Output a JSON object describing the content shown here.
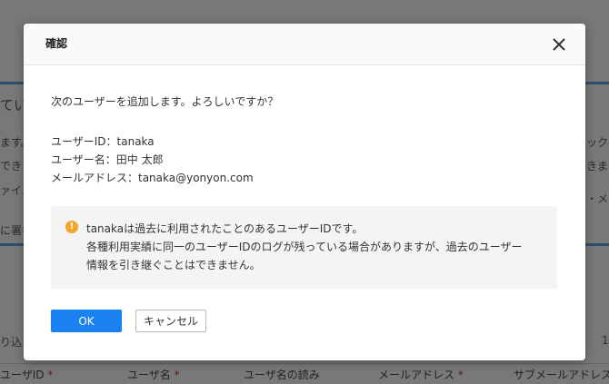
{
  "background": {
    "fragments": [
      "ていま",
      "ます。",
      "できま",
      "ァイル",
      "に署名",
      "ックス",
      "きます",
      "・メ",
      "り込",
      "1"
    ],
    "table_headers": [
      {
        "label": "ユーザID",
        "required": "*"
      },
      {
        "label": "ユーザ名",
        "required": "*"
      },
      {
        "label": "ユーザ名の読み",
        "required": ""
      },
      {
        "label": "メールアドレス",
        "required": "*"
      },
      {
        "label": "サブメールアドレス",
        "required": ""
      }
    ]
  },
  "dialog": {
    "title": "確認",
    "message": "次のユーザーを追加します。よろしいですか？",
    "user_id_line": "ユーザーID：tanaka",
    "user_name_line": "ユーザー名：田中 太郎",
    "email_line": "メールアドレス：tanaka@yonyon.com",
    "warning": {
      "icon": "!",
      "line1": "tanakaは過去に利用されたことのあるユーザーIDです。",
      "line2": "各種利用実績に同一のユーザーIDのログが残っている場合がありますが、過去のユーザー",
      "line3": "情報を引き継ぐことはできません。"
    },
    "ok_label": "OK",
    "cancel_label": "キャンセル"
  },
  "colors": {
    "primary": "#1a82f0",
    "warning": "#f0a72a"
  }
}
